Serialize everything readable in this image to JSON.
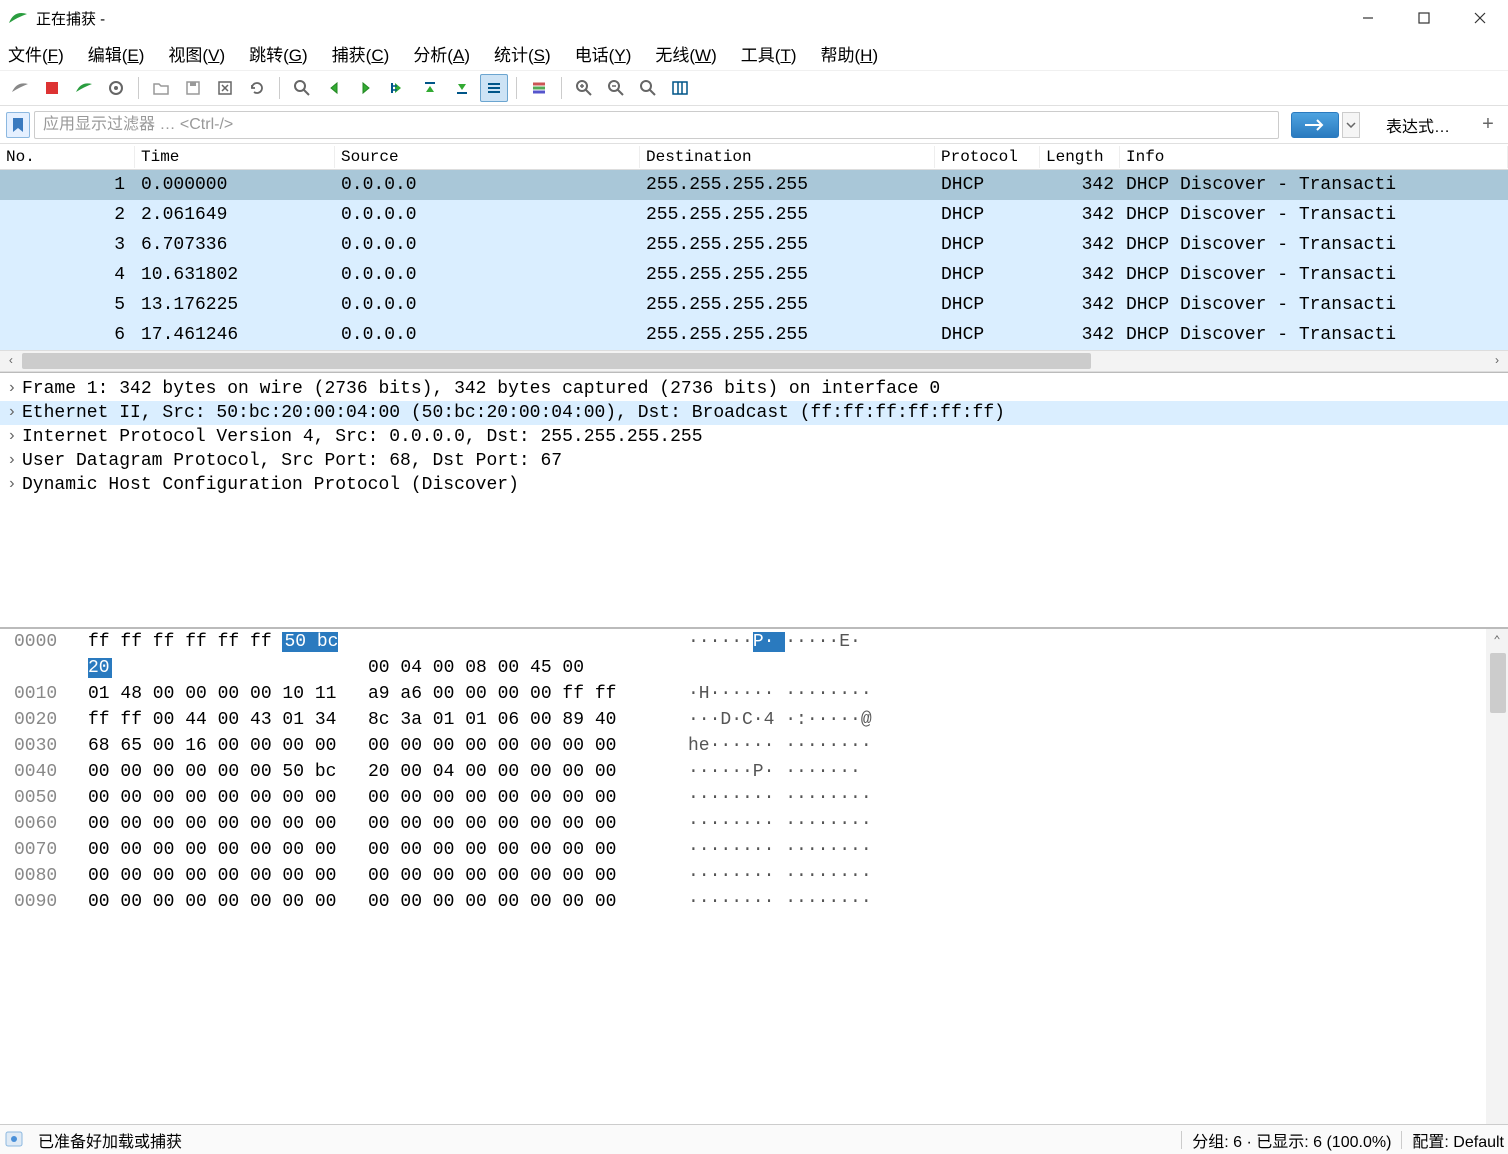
{
  "window": {
    "title": "正在捕获 -"
  },
  "menu": {
    "file": "文件(F)",
    "edit": "编辑(E)",
    "view": "视图(V)",
    "go": "跳转(G)",
    "capture": "捕获(C)",
    "analyze": "分析(A)",
    "stats": "统计(S)",
    "telephony": "电话(Y)",
    "wireless": "无线(W)",
    "tools": "工具(T)",
    "help": "帮助(H)"
  },
  "filter": {
    "placeholder": "应用显示过滤器 … <Ctrl-/>",
    "expr_label": "表达式…"
  },
  "packet_list": {
    "headers": {
      "no": "No.",
      "time": "Time",
      "source": "Source",
      "destination": "Destination",
      "protocol": "Protocol",
      "length": "Length",
      "info": "Info"
    },
    "rows": [
      {
        "no": "1",
        "time": "0.000000",
        "src": "0.0.0.0",
        "dst": "255.255.255.255",
        "proto": "DHCP",
        "len": "342",
        "info": "DHCP Discover - Transacti",
        "selected": true
      },
      {
        "no": "2",
        "time": "2.061649",
        "src": "0.0.0.0",
        "dst": "255.255.255.255",
        "proto": "DHCP",
        "len": "342",
        "info": "DHCP Discover - Transacti",
        "selected": false
      },
      {
        "no": "3",
        "time": "6.707336",
        "src": "0.0.0.0",
        "dst": "255.255.255.255",
        "proto": "DHCP",
        "len": "342",
        "info": "DHCP Discover - Transacti",
        "selected": false
      },
      {
        "no": "4",
        "time": "10.631802",
        "src": "0.0.0.0",
        "dst": "255.255.255.255",
        "proto": "DHCP",
        "len": "342",
        "info": "DHCP Discover - Transacti",
        "selected": false
      },
      {
        "no": "5",
        "time": "13.176225",
        "src": "0.0.0.0",
        "dst": "255.255.255.255",
        "proto": "DHCP",
        "len": "342",
        "info": "DHCP Discover - Transacti",
        "selected": false
      },
      {
        "no": "6",
        "time": "17.461246",
        "src": "0.0.0.0",
        "dst": "255.255.255.255",
        "proto": "DHCP",
        "len": "342",
        "info": "DHCP Discover - Transacti",
        "selected": false
      }
    ]
  },
  "details": {
    "lines": [
      {
        "text": "Frame 1: 342 bytes on wire (2736 bits), 342 bytes captured (2736 bits) on interface 0",
        "hl": false
      },
      {
        "text": "Ethernet II, Src: 50:bc:20:00:04:00 (50:bc:20:00:04:00), Dst: Broadcast (ff:ff:ff:ff:ff:ff)",
        "hl": true
      },
      {
        "text": "Internet Protocol Version 4, Src: 0.0.0.0, Dst: 255.255.255.255",
        "hl": false
      },
      {
        "text": "User Datagram Protocol, Src Port: 68, Dst Port: 67",
        "hl": false
      },
      {
        "text": "Dynamic Host Configuration Protocol (Discover)",
        "hl": false
      }
    ]
  },
  "hex": {
    "rows": [
      {
        "off": "0000",
        "b1a": "ff ff ff ff ff ff ",
        "b1s": "50 bc  20",
        "b1b": "",
        "b2": "00 04 00 08 00 45 00",
        "a1": "······",
        "as": "P·  ",
        "a2": "·····E·"
      },
      {
        "off": "0010",
        "b1a": "01 48 00 00 00 00 10 11",
        "b1s": "",
        "b1b": "",
        "b2": " a9 a6 00 00 00 00 ff ff",
        "a1": "·H······ ········",
        "as": "",
        "a2": ""
      },
      {
        "off": "0020",
        "b1a": "ff ff 00 44 00 43 01 34",
        "b1s": "",
        "b1b": "",
        "b2": " 8c 3a 01 01 06 00 89 40",
        "a1": "···D·C·4 ·:·····@",
        "as": "",
        "a2": ""
      },
      {
        "off": "0030",
        "b1a": "68 65 00 16 00 00 00 00",
        "b1s": "",
        "b1b": "",
        "b2": " 00 00 00 00 00 00 00 00",
        "a1": "he······ ········",
        "as": "",
        "a2": ""
      },
      {
        "off": "0040",
        "b1a": "00 00 00 00 00 00 50 bc",
        "b1s": "",
        "b1b": "",
        "b2": " 20 00 04 00 00 00 00 00",
        "a1": "······P·  ·······",
        "as": "",
        "a2": ""
      },
      {
        "off": "0050",
        "b1a": "00 00 00 00 00 00 00 00",
        "b1s": "",
        "b1b": "",
        "b2": " 00 00 00 00 00 00 00 00",
        "a1": "········ ········",
        "as": "",
        "a2": ""
      },
      {
        "off": "0060",
        "b1a": "00 00 00 00 00 00 00 00",
        "b1s": "",
        "b1b": "",
        "b2": " 00 00 00 00 00 00 00 00",
        "a1": "········ ········",
        "as": "",
        "a2": ""
      },
      {
        "off": "0070",
        "b1a": "00 00 00 00 00 00 00 00",
        "b1s": "",
        "b1b": "",
        "b2": " 00 00 00 00 00 00 00 00",
        "a1": "········ ········",
        "as": "",
        "a2": ""
      },
      {
        "off": "0080",
        "b1a": "00 00 00 00 00 00 00 00",
        "b1s": "",
        "b1b": "",
        "b2": " 00 00 00 00 00 00 00 00",
        "a1": "········ ········",
        "as": "",
        "a2": ""
      },
      {
        "off": "0090",
        "b1a": "00 00 00 00 00 00 00 00",
        "b1s": "",
        "b1b": "",
        "b2": " 00 00 00 00 00 00 00 00",
        "a1": "········ ········",
        "as": "",
        "a2": ""
      }
    ]
  },
  "statusbar": {
    "ready": "已准备好加载或捕获",
    "packets": "分组: 6 · 已显示: 6 (100.0%)",
    "profile": "配置: Default"
  }
}
